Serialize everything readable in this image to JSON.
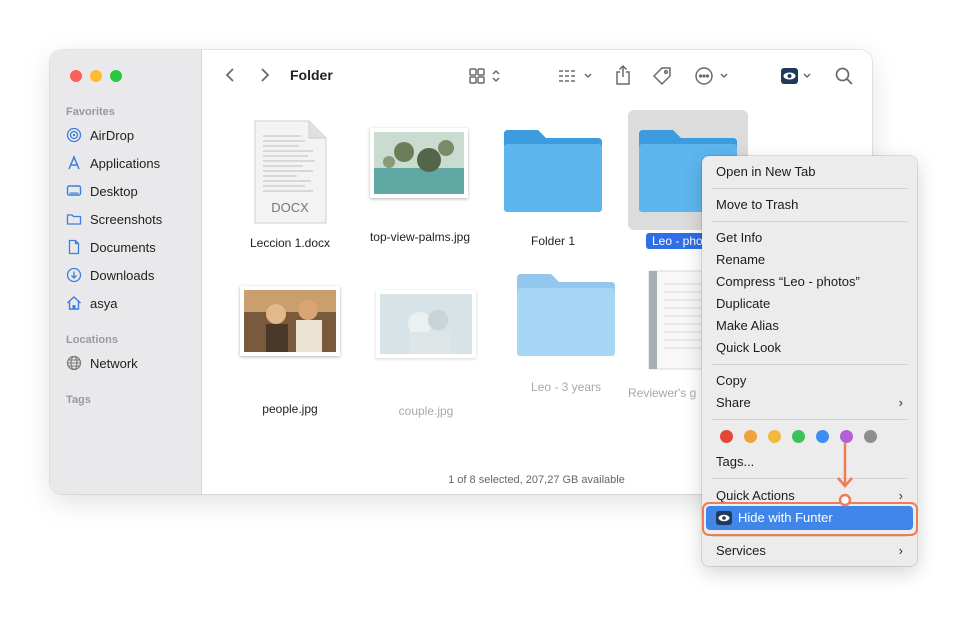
{
  "window": {
    "title": "Folder"
  },
  "sidebar": {
    "favorites_title": "Favorites",
    "favorites": [
      {
        "label": "AirDrop",
        "icon": "airdrop-icon"
      },
      {
        "label": "Applications",
        "icon": "applications-icon"
      },
      {
        "label": "Desktop",
        "icon": "desktop-icon"
      },
      {
        "label": "Screenshots",
        "icon": "folder-icon"
      },
      {
        "label": "Documents",
        "icon": "document-icon"
      },
      {
        "label": "Downloads",
        "icon": "download-icon"
      },
      {
        "label": "asya",
        "icon": "home-icon"
      }
    ],
    "locations_title": "Locations",
    "locations": [
      {
        "label": "Network",
        "icon": "network-icon"
      }
    ],
    "tags_title": "Tags"
  },
  "files": [
    {
      "name": "Leccion 1.docx",
      "kind": "docx",
      "badge": "DOCX"
    },
    {
      "name": "top-view-palms.jpg",
      "kind": "image"
    },
    {
      "name": "Folder 1",
      "kind": "folder"
    },
    {
      "name": "Leo - photos",
      "visible_label": "Leo - pho",
      "kind": "folder",
      "selected": true
    },
    {
      "name": "people.jpg",
      "kind": "image"
    },
    {
      "name": "couple.jpg",
      "kind": "image",
      "hidden": true
    },
    {
      "name": "Leo - 3 years",
      "kind": "folder",
      "hidden": true
    },
    {
      "name": "Reviewer's g",
      "kind": "document",
      "hidden": true
    }
  ],
  "status_bar": "1 of 8 selected, 207,27 GB available",
  "context_menu": {
    "items": [
      {
        "label": "Open in New Tab"
      },
      {
        "label": "Move to Trash"
      },
      {
        "label": "Get Info"
      },
      {
        "label": "Rename"
      },
      {
        "label": "Compress “Leo - photos”"
      },
      {
        "label": "Duplicate"
      },
      {
        "label": "Make Alias"
      },
      {
        "label": "Quick Look"
      },
      {
        "label": "Copy"
      },
      {
        "label": "Share"
      },
      {
        "label": "Tags..."
      },
      {
        "label": "Quick Actions"
      },
      {
        "label": "Hide with Funter"
      },
      {
        "label": "Services"
      }
    ],
    "tag_colors": [
      "#e5463a",
      "#f0a23e",
      "#f2b83f",
      "#3cc15b",
      "#3d8ef0",
      "#b45fd6",
      "#8e8e8e"
    ],
    "chevron": "›"
  },
  "colors": {
    "accent": "#3f86e8",
    "callout": "#f07c55",
    "folder": "#5eb6ef"
  }
}
